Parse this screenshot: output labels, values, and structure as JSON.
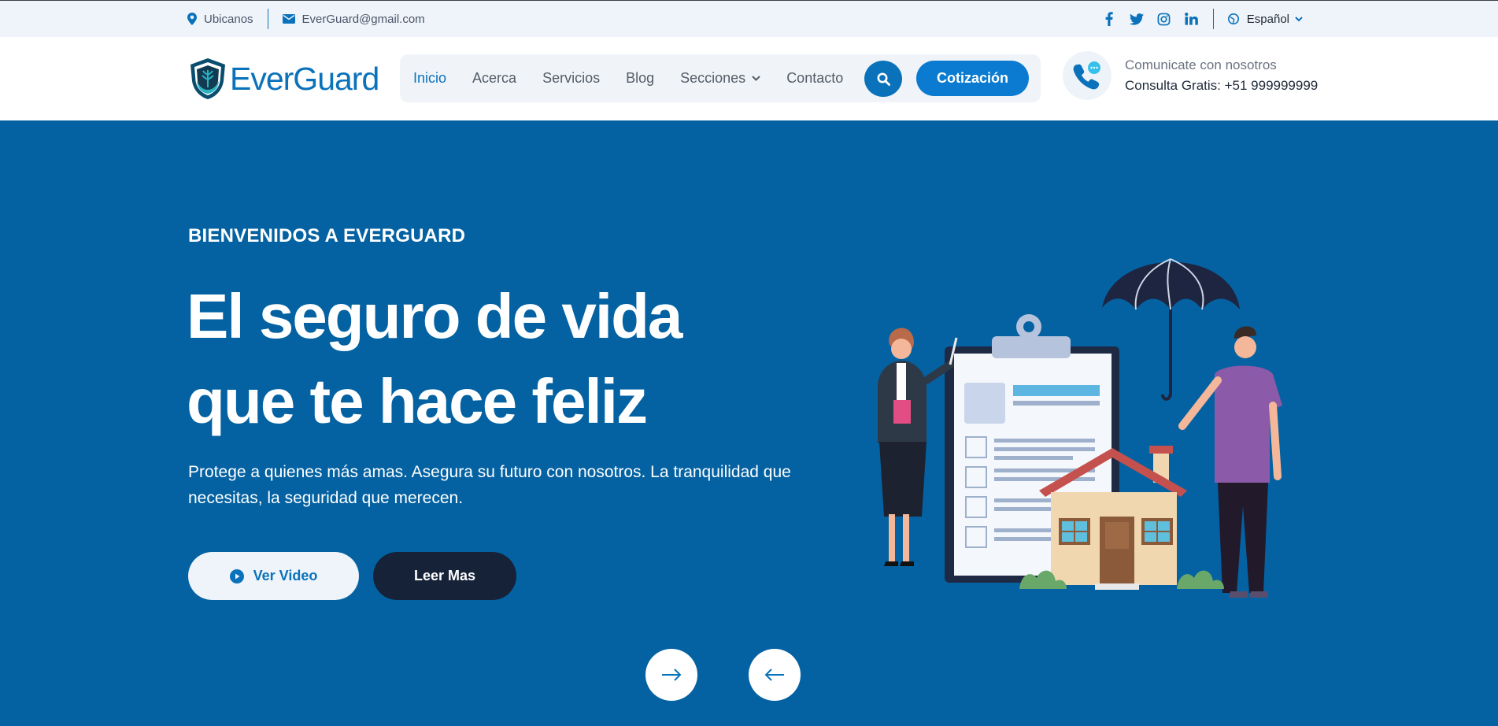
{
  "topbar": {
    "location_label": "Ubicanos",
    "email_label": "EverGuard@gmail.com",
    "language_label": "Español",
    "social_icons": [
      "facebook-icon",
      "twitter-icon",
      "instagram-icon",
      "linkedin-icon"
    ]
  },
  "header": {
    "brand": "EverGuard",
    "nav": [
      "Inicio",
      "Acerca",
      "Servicios",
      "Blog",
      "Secciones",
      "Contacto"
    ],
    "active_nav": "Inicio",
    "quote_button": "Cotización",
    "contact_line1": "Comunicate con nosotros",
    "contact_line2": "Consulta Gratis: +51 999999999"
  },
  "hero": {
    "eyebrow": "BIENVENIDOS A EVERGUARD",
    "title_line1": "El seguro de vida",
    "title_line2": "que te hace feliz",
    "description": "Protege a quienes más amas. Asegura su futuro con nosotros. La tranquilidad que necesitas, la seguridad que merecen.",
    "video_button": "Ver Video",
    "more_button": "Leer Mas"
  },
  "colors": {
    "brand_blue": "#0a72ba",
    "hero_bg": "#0462a2",
    "dark_navy": "#152238",
    "topbar_bg": "#eff4fa"
  }
}
